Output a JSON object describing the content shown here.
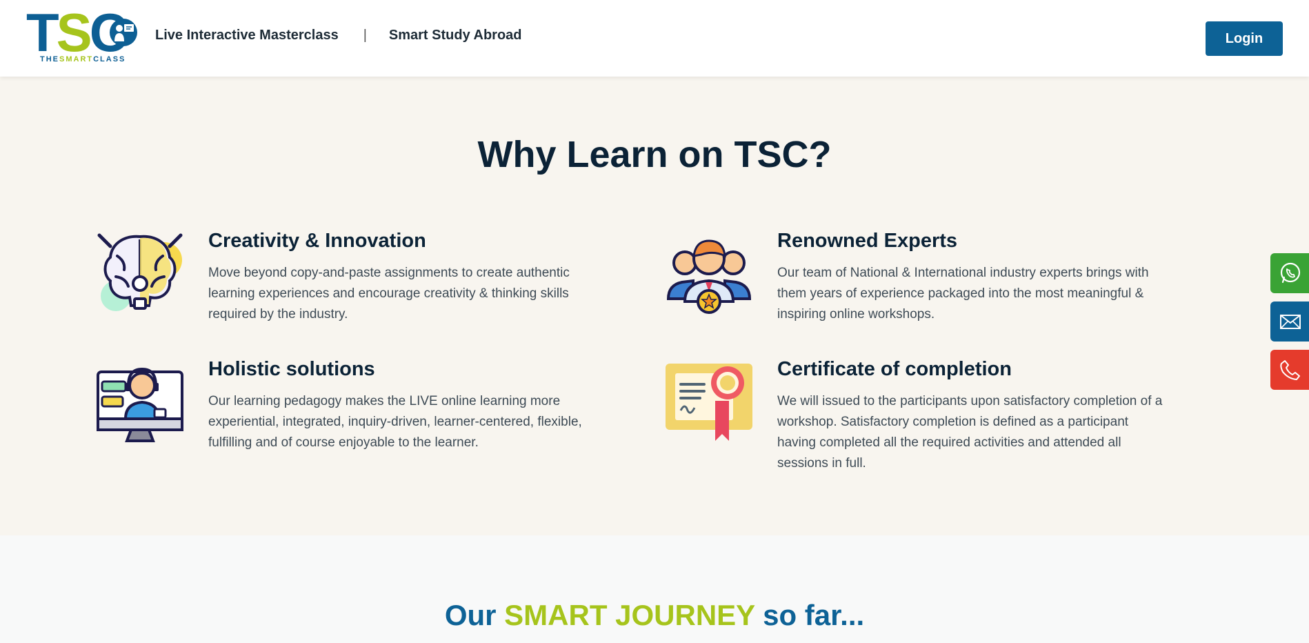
{
  "header": {
    "logo": {
      "letters": [
        "T",
        "S",
        "C"
      ],
      "sub_part1": "THE",
      "sub_part2": "SMART",
      "sub_part3": "CLASS"
    },
    "nav": [
      {
        "label": "Live Interactive Masterclass"
      },
      {
        "label": "Smart Study Abroad"
      }
    ],
    "separator": "|",
    "login_label": "Login"
  },
  "why": {
    "title": "Why Learn on TSC?",
    "features": [
      {
        "icon": "brain-lightbulb-icon",
        "title": "Creativity & Innovation",
        "text": "Move beyond copy-and-paste assignments to create authentic learning experiences and encourage creativity & thinking skills required by the industry."
      },
      {
        "icon": "experts-group-icon",
        "title": "Renowned Experts",
        "text": "Our team of National & International industry experts brings with them years of experience packaged into the most meaningful & inspiring online workshops."
      },
      {
        "icon": "online-learning-icon",
        "title": "Holistic solutions",
        "text": "Our learning pedagogy makes the LIVE online learning more experiential, integrated, inquiry-driven, learner-centered, flexible, fulfilling and of course enjoyable to the learner."
      },
      {
        "icon": "certificate-icon",
        "title": "Certificate of completion",
        "text": "We will issued to the participants upon satisfactory completion of a workshop. Satisfactory completion is defined as a participant having completed all the required activities and attended all sessions in full."
      }
    ]
  },
  "journey": {
    "title_part1": "Our",
    "title_part2": "SMART JOURNEY",
    "title_part3": "so far..."
  },
  "floating_contacts": [
    {
      "icon": "whatsapp-icon",
      "color": "#3aa335"
    },
    {
      "icon": "mail-icon",
      "color": "#0d6296"
    },
    {
      "icon": "phone-icon",
      "color": "#e53b2c"
    }
  ],
  "colors": {
    "brand_blue": "#0d6296",
    "brand_green": "#a6c41c",
    "heading": "#0b2236",
    "section_bg": "#f8f5ef"
  }
}
